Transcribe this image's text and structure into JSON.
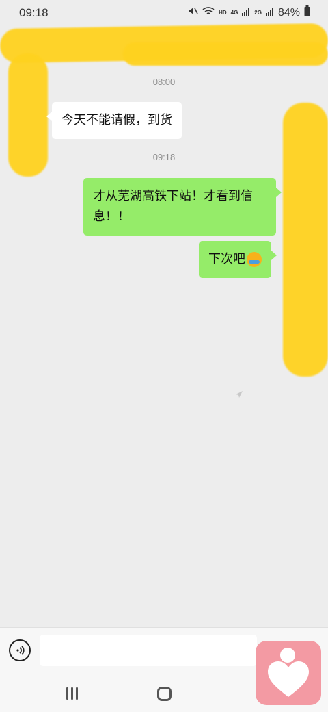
{
  "status_bar": {
    "time": "09:18",
    "hd_label": "HD",
    "net_4g": "4G",
    "net_2g": "2G",
    "battery": "84%"
  },
  "chat": {
    "messages": [
      {
        "timestamp": "08:00",
        "direction": "in",
        "text": "今天不能请假，到货"
      },
      {
        "timestamp": "09:18",
        "direction": "out",
        "text": "才从芜湖高铁下站！才看到信息！！"
      },
      {
        "direction": "out",
        "text": "下次吧",
        "emoji": "laughing-crying-emoji"
      }
    ]
  },
  "input_bar": {
    "voice_icon": "voice-icon",
    "text_value": ""
  },
  "nav_bar": {
    "recent_icon": "recent-apps-icon",
    "home_icon": "home-icon"
  },
  "widget": {
    "icon": "heart-widget-icon",
    "color": "#f39aa3"
  },
  "colors": {
    "bubble_out": "#95ec69",
    "bubble_in": "#ffffff",
    "background": "#ededed",
    "scribble": "#ffd21f"
  }
}
